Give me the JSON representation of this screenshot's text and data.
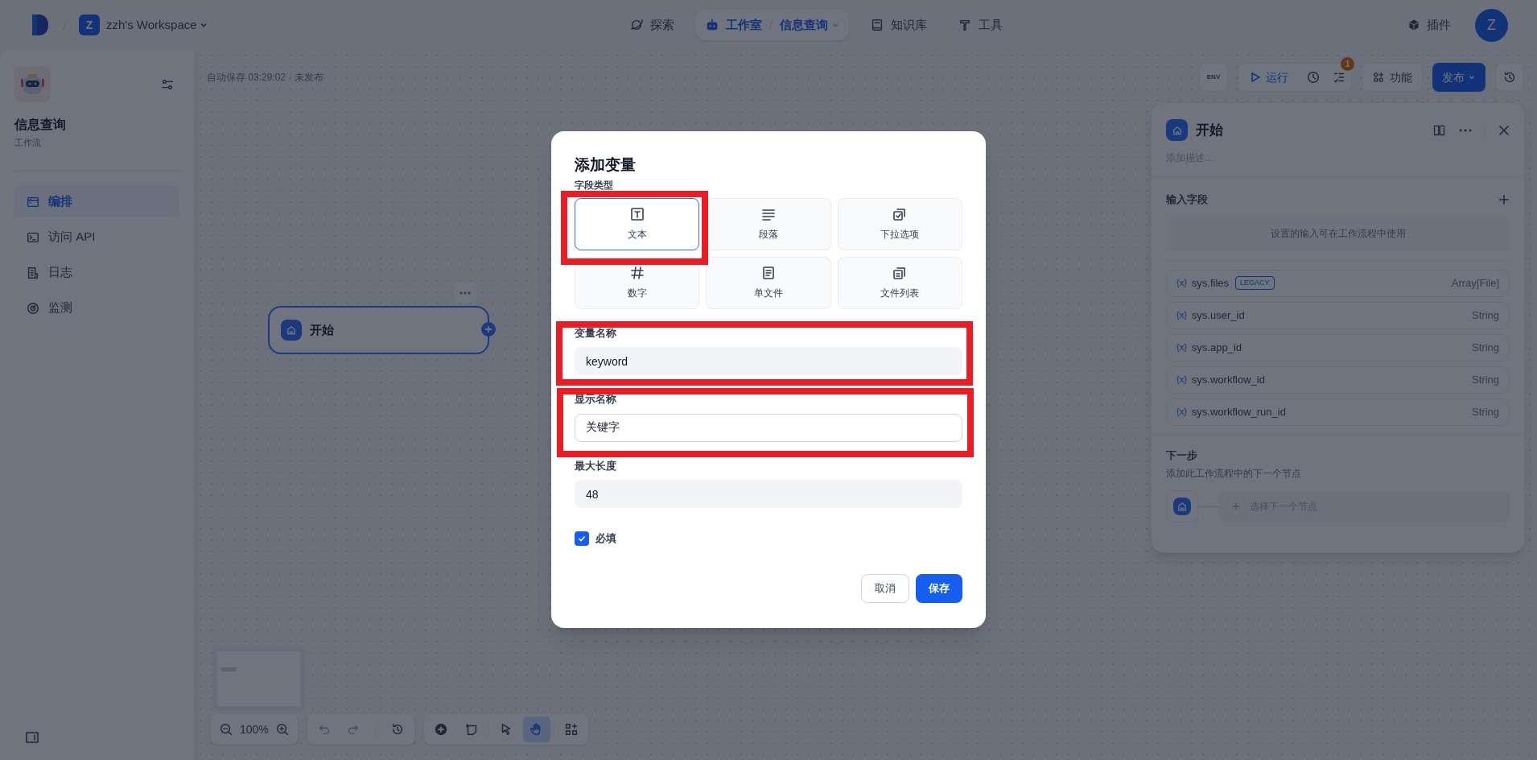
{
  "top_bar": {
    "workspace_initial": "Z",
    "workspace": "zzh's Workspace",
    "nav": [
      {
        "kind": "explore",
        "label": "探索",
        "selected": false
      },
      {
        "kind": "studio",
        "label": "工作室",
        "selected": true,
        "breadcrumb": "信息查询"
      },
      {
        "kind": "knowledge",
        "label": "知识库",
        "selected": false
      },
      {
        "kind": "tools",
        "label": "工具",
        "selected": false
      }
    ],
    "plugins": "插件",
    "avatar": "Z"
  },
  "sidebar": {
    "app_name": "信息查询",
    "app_type": "工作流",
    "items": [
      {
        "kind": "layout",
        "label": "编排",
        "selected": true
      },
      {
        "kind": "api",
        "label": "访问 API",
        "selected": false
      },
      {
        "kind": "logs",
        "label": "日志",
        "selected": false
      },
      {
        "kind": "monitor",
        "label": "监测",
        "selected": false
      }
    ]
  },
  "canvas": {
    "autosave": "自动保存 03:29:02 · 未发布",
    "env": "ENV",
    "run": "运行",
    "checklist_count": "1",
    "features": "功能",
    "publish": "发布",
    "node": {
      "title": "开始"
    },
    "zoom": "100%",
    "tools": [
      {
        "kind": "add",
        "selected": false
      },
      {
        "kind": "note",
        "selected": false
      },
      {
        "kind": "pointer",
        "selected": false
      },
      {
        "kind": "hand",
        "selected": true
      },
      {
        "kind": "organize",
        "selected": false
      }
    ]
  },
  "panel": {
    "title": "开始",
    "description_placeholder": "添加描述...",
    "inputs_title": "输入字段",
    "empty_hint": "设置的输入可在工作流程中使用",
    "variables": [
      {
        "icon": "{x}",
        "name": "sys.files",
        "tag": "LEGACY",
        "type": "Array[File]"
      },
      {
        "icon": "{x}",
        "name": "sys.user_id",
        "type": "String"
      },
      {
        "icon": "{x}",
        "name": "sys.app_id",
        "type": "String"
      },
      {
        "icon": "{x}",
        "name": "sys.workflow_id",
        "type": "String"
      },
      {
        "icon": "{x}",
        "name": "sys.workflow_run_id",
        "type": "String"
      }
    ],
    "next_title": "下一步",
    "next_description": "添加此工作流程中的下一个节点",
    "next_placeholder": "选择下一个节点"
  },
  "dialog": {
    "title": "添加变量",
    "field_type_label": "字段类型",
    "field_types": [
      {
        "kind": "text",
        "label": "文本",
        "selected": true
      },
      {
        "kind": "paragraph",
        "label": "段落",
        "selected": false
      },
      {
        "kind": "select",
        "label": "下拉选项",
        "selected": false
      },
      {
        "kind": "number",
        "label": "数字",
        "selected": false
      },
      {
        "kind": "file",
        "label": "单文件",
        "selected": false
      },
      {
        "kind": "file_list",
        "label": "文件列表",
        "selected": false
      }
    ],
    "fields": [
      {
        "label": "变量名称",
        "value": "keyword",
        "focused": false
      },
      {
        "label": "显示名称",
        "value": "关键字",
        "focused": true
      },
      {
        "label": "最大长度",
        "value": "48",
        "focused": false
      }
    ],
    "required": {
      "label": "必填",
      "checked": true
    },
    "cancel": "取消",
    "save": "保存"
  }
}
